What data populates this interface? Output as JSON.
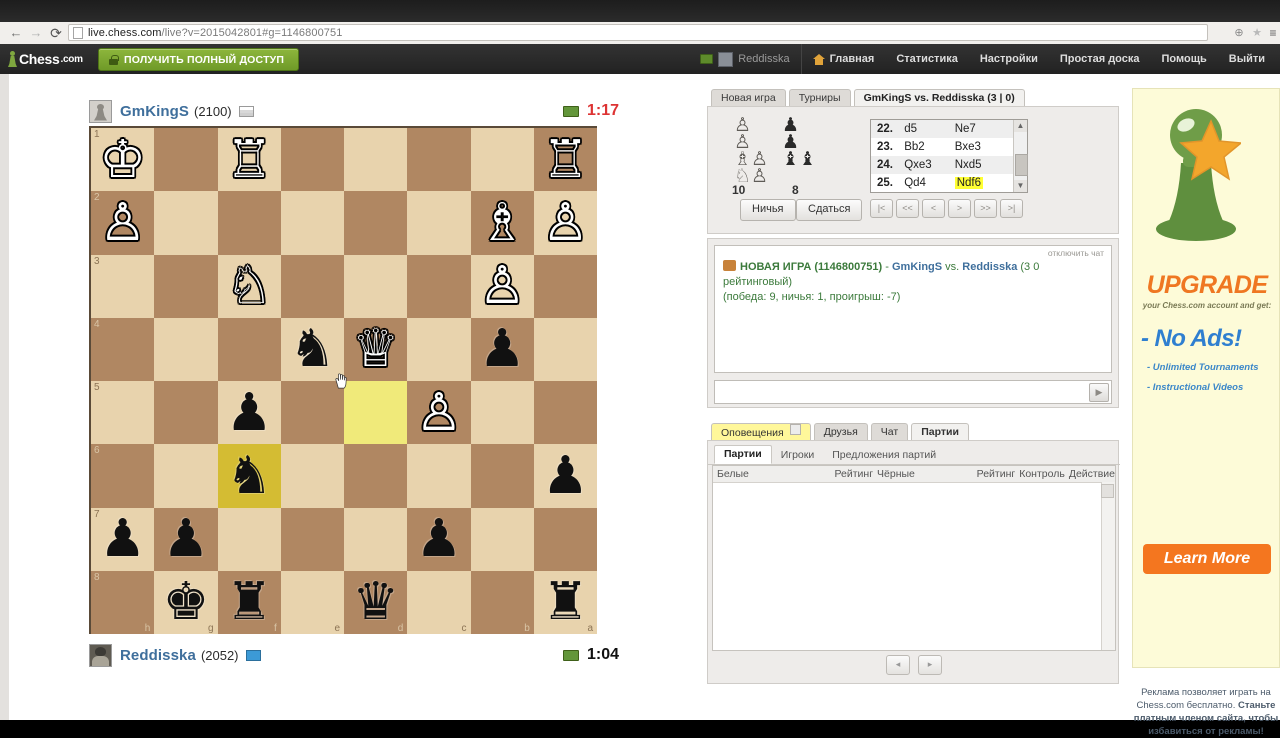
{
  "browser": {
    "url_main": "live.chess.com",
    "url_rest": "/live?v=2015042801#g=1146800751",
    "back_icon": "←",
    "forward_icon": "→",
    "reload_icon": "⟳",
    "zoom_icon": "⊕",
    "star_icon": "★",
    "menu_icon": "≡"
  },
  "header": {
    "brand": "Chess",
    "brand_suffix": ".com",
    "upgrade_label": "ПОЛУЧИТЬ ПОЛНЫЙ ДОСТУП",
    "nav": [
      {
        "label": "Reddisska"
      },
      {
        "label": "Главная"
      },
      {
        "label": "Статистика"
      },
      {
        "label": "Настройки"
      },
      {
        "label": "Простая доска"
      },
      {
        "label": "Помощь"
      },
      {
        "label": "Выйти"
      }
    ]
  },
  "players": {
    "top": {
      "name": "GmKingS",
      "rating": "(2100)",
      "clock": "1:17"
    },
    "bottom": {
      "name": "Reddisska",
      "rating": "(2052)",
      "clock": "1:04"
    }
  },
  "board": {
    "orientation": "black",
    "rank_labels": [
      "1",
      "2",
      "3",
      "4",
      "5",
      "6",
      "7",
      "8"
    ],
    "file_labels": [
      "h",
      "g",
      "f",
      "e",
      "d",
      "c",
      "b",
      "a"
    ],
    "highlight_squares": [
      "d5",
      "f6"
    ],
    "rows": [
      [
        "♔",
        "",
        "♖",
        "",
        "",
        "",
        "",
        "♖"
      ],
      [
        "♙",
        "",
        "",
        "",
        "",
        "",
        "♗",
        "♙"
      ],
      [
        "",
        "",
        "♘",
        "",
        "",
        "",
        "♙",
        ""
      ],
      [
        "",
        "",
        "",
        "♞",
        "♕",
        "",
        "♟",
        ""
      ],
      [
        "",
        "",
        "♟",
        "",
        "",
        "♙",
        "",
        ""
      ],
      [
        "",
        "",
        "♞",
        "",
        "",
        "",
        "",
        "♟"
      ],
      [
        "♟",
        "♟",
        "",
        "",
        "",
        "♟",
        "",
        ""
      ],
      [
        "",
        "♚",
        "♜",
        "",
        "♛",
        "",
        "",
        "♜"
      ]
    ],
    "piece_colors": [
      [
        "w",
        "",
        "w",
        "",
        "",
        "",
        "",
        "w"
      ],
      [
        "w",
        "",
        "",
        "",
        "",
        "",
        "w",
        "w"
      ],
      [
        "",
        "",
        "w",
        "",
        "",
        "",
        "w",
        ""
      ],
      [
        "",
        "",
        "",
        "b",
        "w",
        "",
        "b",
        ""
      ],
      [
        "",
        "",
        "b",
        "",
        "",
        "w",
        "",
        ""
      ],
      [
        "",
        "",
        "b",
        "",
        "",
        "",
        "",
        "b"
      ],
      [
        "b",
        "b",
        "",
        "",
        "",
        "b",
        "",
        ""
      ],
      [
        "",
        "b",
        "b",
        "",
        "b",
        "",
        "",
        "b"
      ]
    ]
  },
  "game_tabs": [
    {
      "label": "Новая игра",
      "active": false
    },
    {
      "label": "Турниры",
      "active": false
    },
    {
      "label": "GmKingS vs. Reddisska (3 | 0)",
      "active": true
    }
  ],
  "captured": {
    "white_glyphs": "♙\n♙\n♗♙\n♘♙",
    "black_glyphs": "♟\n♟\n♝♝",
    "white_count": "10",
    "black_count": "8",
    "draw_label": "Ничья",
    "resign_label": "Сдаться"
  },
  "moves": [
    {
      "no": "22.",
      "white": "d5",
      "black": "Ne7",
      "highlight": false
    },
    {
      "no": "23.",
      "white": "Bb2",
      "black": "Bxe3",
      "highlight": false
    },
    {
      "no": "24.",
      "white": "Qxe3",
      "black": "Nxd5",
      "highlight": false
    },
    {
      "no": "25.",
      "white": "Qd4",
      "black": "Ndf6",
      "highlight": true
    }
  ],
  "move_nav": [
    "|<",
    "<<",
    "<",
    ">",
    ">>",
    ">|"
  ],
  "chat": {
    "toggle_label": "отключить чат",
    "line1_prefix": "НОВАЯ ИГРА (1146800751)",
    "line1_dash": " - ",
    "line1_p1": "GmKingS",
    "line1_vs": " vs. ",
    "line1_p2": "Reddisska",
    "line1_suffix": " (3 0 рейтинговый)",
    "line2": "(победа: 9, ничья: 1, проигрыш: -7)",
    "input_value": "",
    "send_icon": "▶"
  },
  "lower_tabs": [
    {
      "label": "Оповещения",
      "notice": true,
      "active": false
    },
    {
      "label": "Друзья",
      "notice": false,
      "active": false
    },
    {
      "label": "Чат",
      "notice": false,
      "active": false
    },
    {
      "label": "Партии",
      "notice": false,
      "active": true
    }
  ],
  "sub_tabs": [
    {
      "label": "Партии",
      "active": true
    },
    {
      "label": "Игроки",
      "active": false
    },
    {
      "label": "Предложения партий",
      "active": false
    }
  ],
  "games_table": {
    "columns": [
      "Белые",
      "Рейтинг",
      "Чёрные",
      "Рейтинг",
      "Контроль",
      "Действие"
    ],
    "rows": []
  },
  "pager": {
    "prev": "◂",
    "next": "▸"
  },
  "ad": {
    "upgrade": "UPGRADE",
    "subtitle": "your Chess.com account and get:",
    "noads": "- No Ads!",
    "bullet1": "-   Unlimited Tournaments",
    "bullet2": "-   Instructional Videos",
    "learn_more": "Learn More",
    "note_1": "Реклама позволяет играть на",
    "note_2": "Chess.com бесплатно.",
    "note_3": "Станьте платным членом сайта, чтобы избавиться от рекламы!"
  },
  "colors": {
    "board_light": "#e8d3ad",
    "board_dark": "#b08762",
    "highlight_light": "#f0ea7a",
    "highlight_dark": "#d4bc33",
    "brand_green": "#7fa73f",
    "accent_orange": "#f4761f",
    "link_blue": "#3f6f9c",
    "clock_red": "#dd3333"
  }
}
